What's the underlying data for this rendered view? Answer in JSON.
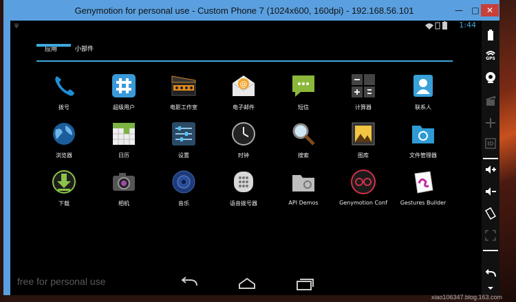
{
  "window": {
    "title": "Genymotion for personal use - Custom Phone 7 (1024x600, 160dpi) - 192.168.56.101",
    "minimize_glyph": "—",
    "maximize_glyph": "□",
    "close_glyph": "✕"
  },
  "statusbar": {
    "time": "1:44",
    "usb_glyph": "ψ"
  },
  "tabs": [
    {
      "label": "应用",
      "active": true
    },
    {
      "label": "小部件",
      "active": false
    }
  ],
  "apps": [
    {
      "label": "拨号",
      "icon": "phone-icon"
    },
    {
      "label": "超级用户",
      "icon": "superuser-icon"
    },
    {
      "label": "电影工作室",
      "icon": "movie-studio-icon"
    },
    {
      "label": "电子邮件",
      "icon": "email-icon"
    },
    {
      "label": "短信",
      "icon": "messaging-icon"
    },
    {
      "label": "计算器",
      "icon": "calculator-icon"
    },
    {
      "label": "联系人",
      "icon": "contacts-icon"
    },
    {
      "label": "浏览器",
      "icon": "browser-globe-icon"
    },
    {
      "label": "日历",
      "icon": "calendar-icon"
    },
    {
      "label": "设置",
      "icon": "settings-icon"
    },
    {
      "label": "时钟",
      "icon": "clock-icon"
    },
    {
      "label": "搜索",
      "icon": "search-magnifier-icon"
    },
    {
      "label": "图库",
      "icon": "gallery-icon"
    },
    {
      "label": "文件管理器",
      "icon": "file-manager-icon"
    },
    {
      "label": "下载",
      "icon": "download-icon"
    },
    {
      "label": "相机",
      "icon": "camera-icon"
    },
    {
      "label": "音乐",
      "icon": "music-speaker-icon"
    },
    {
      "label": "语音拨号器",
      "icon": "voice-dialer-icon"
    },
    {
      "label": "API Demos",
      "icon": "api-demos-folder-icon"
    },
    {
      "label": "Genymotion Conf",
      "icon": "genymotion-config-icon"
    },
    {
      "label": "Gestures Builder",
      "icon": "gestures-builder-icon"
    }
  ],
  "watermark": "free for personal use",
  "sidebar": {
    "gps_label": "GPS",
    "id_label": "ID"
  },
  "credit": "xiao106347.blog.163.com",
  "colors": {
    "accent": "#3fa9e0",
    "titlebar": "#5aa0e0",
    "screen_bg": "#000000"
  }
}
